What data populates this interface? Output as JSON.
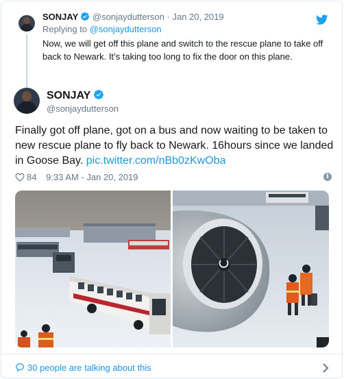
{
  "reply_tweet": {
    "name": "SONJAY",
    "handle": "@sonjaydutterson",
    "separator": "·",
    "date": "Jan 20, 2019",
    "replying_prefix": "Replying to",
    "replying_handle": "@sonjaydutterson",
    "text": "Now, we will get off this plane and switch to the rescue plane to take off back to Newark.  It’s taking too long to fix the door on this plane."
  },
  "main_tweet": {
    "name": "SONJAY",
    "handle": "@sonjaydutterson",
    "text": "Finally got off plane, got on a bus and now waiting to be taken to new rescue plane to fly back to Newark.  16hours since we landed in Goose Bay. ",
    "link": "pic.twitter.com/nBb0zKwOba",
    "likes": "84",
    "timestamp": "9:33 AM - Jan 20, 2019",
    "info_glyph": "i"
  },
  "footer": {
    "talking": "30 people are talking about this"
  },
  "icons": {
    "brand": "twitter-bird-icon",
    "verified": "verified-badge-icon",
    "like": "heart-icon",
    "info": "info-icon",
    "reply": "speech-bubble-icon",
    "more": "chevron-right-icon"
  },
  "colors": {
    "link": "#1b95e0",
    "muted": "#657786",
    "text": "#14171a",
    "border": "#e1e8ed",
    "like": "#e0245e"
  }
}
